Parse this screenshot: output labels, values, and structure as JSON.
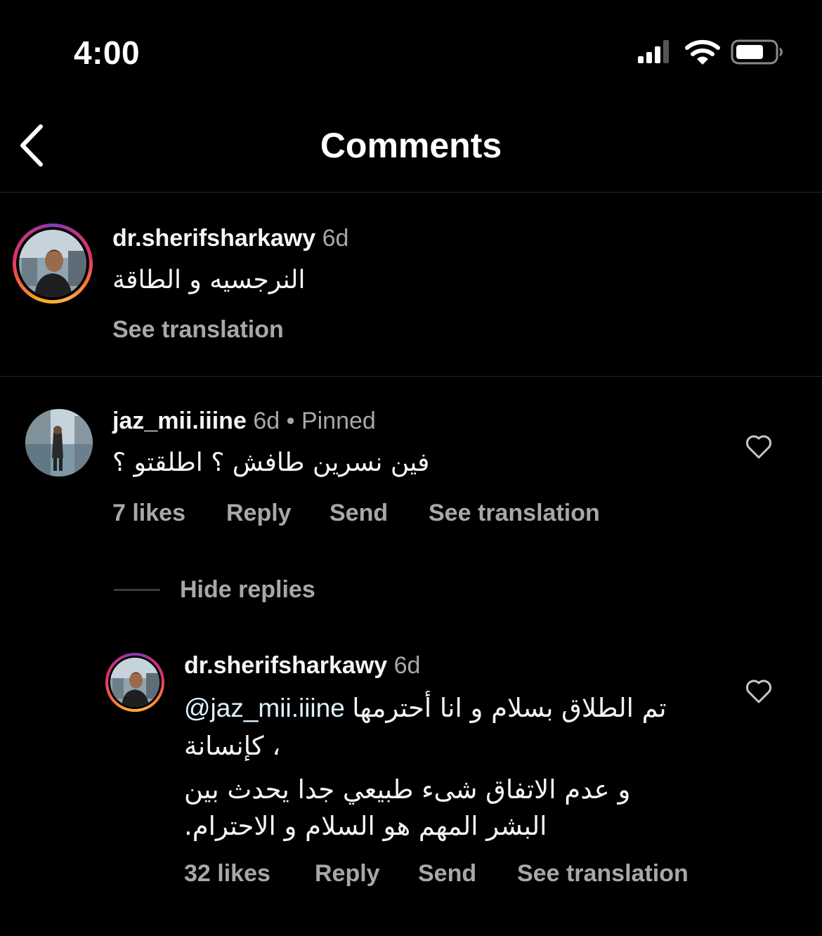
{
  "status_bar": {
    "time": "4:00",
    "icons": [
      "signal-icon",
      "wifi-icon",
      "battery-icon"
    ]
  },
  "header": {
    "back_icon": "chevron-left-icon",
    "title": "Comments"
  },
  "caption": {
    "username": "dr.sherifsharkawy",
    "time": "6d",
    "text": "النرجسيه و الطاقة",
    "see_translation": "See translation"
  },
  "comments": [
    {
      "username": "jaz_mii.iiine",
      "time": "6d",
      "separator": "•",
      "pinned": "Pinned",
      "text": "فين نسرين طافش ؟ اطلقتو ؟",
      "likes": "7 likes",
      "reply": "Reply",
      "send": "Send",
      "see_translation": "See translation",
      "hide_replies": "Hide replies",
      "replies": [
        {
          "username": "dr.sherifsharkawy",
          "time": "6d",
          "mention": "@jaz_mii.iiine",
          "text_line1": "تم الطلاق بسلام و انا أحترمها",
          "text_line2": "، كإنسانة",
          "text_line3": "و عدم الاتفاق شىء طبيعي جدا يحدث بين",
          "text_line4": "البشر المهم هو السلام و الاحترام.",
          "likes": "32 likes",
          "reply": "Reply",
          "send": "Send",
          "see_translation": "See translation"
        }
      ]
    }
  ],
  "colors": {
    "background": "#000000",
    "primary_text": "#f5f5f5",
    "secondary_text": "#a8a8a8",
    "divider": "#262626"
  }
}
